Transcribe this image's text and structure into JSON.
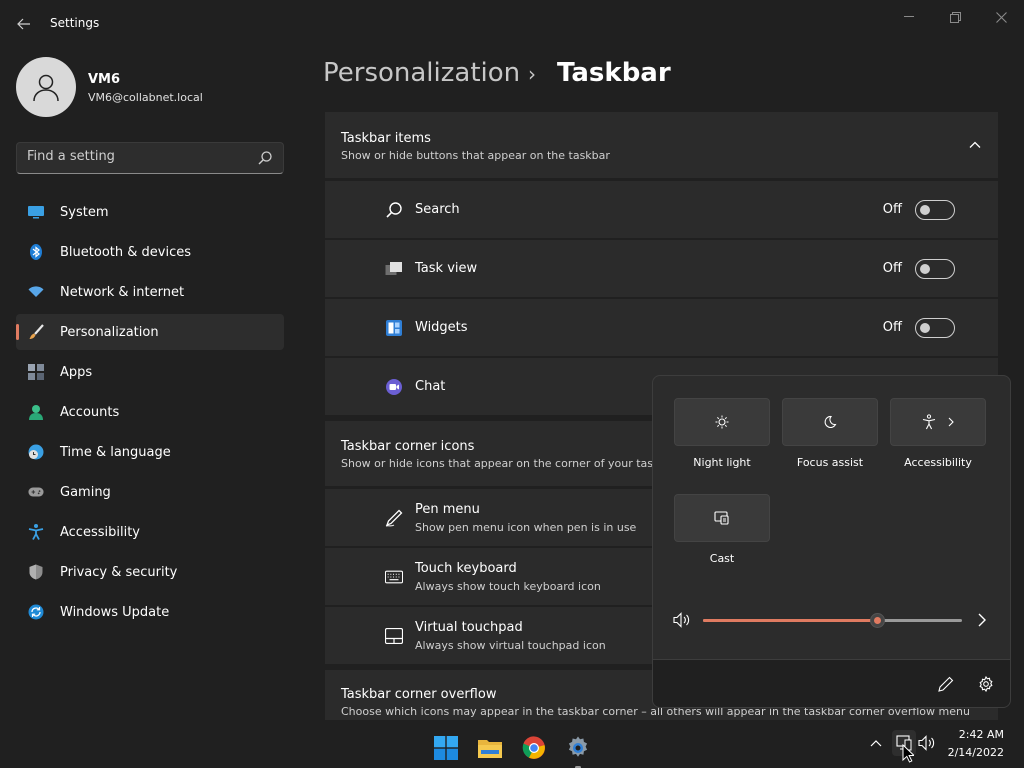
{
  "window": {
    "title": "Settings",
    "controls": {
      "minimize": "—",
      "restore": "❐",
      "close": "✕"
    }
  },
  "profile": {
    "name": "VM6",
    "email": "VM6@collabnet.local"
  },
  "search": {
    "placeholder": "Find a setting"
  },
  "sidebar": {
    "items": [
      {
        "label": "System",
        "icon": "system-icon",
        "active": false
      },
      {
        "label": "Bluetooth & devices",
        "icon": "bluetooth-icon",
        "active": false
      },
      {
        "label": "Network & internet",
        "icon": "wifi-icon",
        "active": false
      },
      {
        "label": "Personalization",
        "icon": "brush-icon",
        "active": true
      },
      {
        "label": "Apps",
        "icon": "apps-icon",
        "active": false
      },
      {
        "label": "Accounts",
        "icon": "accounts-icon",
        "active": false
      },
      {
        "label": "Time & language",
        "icon": "clock-globe-icon",
        "active": false
      },
      {
        "label": "Gaming",
        "icon": "gamepad-icon",
        "active": false
      },
      {
        "label": "Accessibility",
        "icon": "accessibility-icon",
        "active": false
      },
      {
        "label": "Privacy & security",
        "icon": "shield-icon",
        "active": false
      },
      {
        "label": "Windows Update",
        "icon": "update-icon",
        "active": false
      }
    ]
  },
  "header": {
    "parent": "Personalization",
    "separator": "›",
    "current": "Taskbar"
  },
  "taskbar_items": {
    "title": "Taskbar items",
    "subtitle": "Show or hide buttons that appear on the taskbar",
    "rows": [
      {
        "label": "Search",
        "state": "Off",
        "icon": "search-icon"
      },
      {
        "label": "Task view",
        "state": "Off",
        "icon": "task-view-icon"
      },
      {
        "label": "Widgets",
        "state": "Off",
        "icon": "widgets-icon"
      },
      {
        "label": "Chat",
        "icon": "chat-icon"
      }
    ]
  },
  "corner_icons": {
    "title": "Taskbar corner icons",
    "subtitle": "Show or hide icons that appear on the corner of your taskbar",
    "rows": [
      {
        "label": "Pen menu",
        "sub": "Show pen menu icon when pen is in use",
        "icon": "pen-icon"
      },
      {
        "label": "Touch keyboard",
        "sub": "Always show touch keyboard icon",
        "icon": "keyboard-icon"
      },
      {
        "label": "Virtual touchpad",
        "sub": "Always show virtual touchpad icon",
        "icon": "touchpad-icon"
      }
    ]
  },
  "corner_overflow": {
    "title": "Taskbar corner overflow",
    "subtitle": "Choose which icons may appear in the taskbar corner – all others will appear in the taskbar corner overflow menu"
  },
  "quick_settings": {
    "tiles": [
      {
        "label": "Night light",
        "icon": "night-light-icon"
      },
      {
        "label": "Focus assist",
        "icon": "moon-icon"
      },
      {
        "label": "Accessibility",
        "icon": "accessibility-icon"
      },
      {
        "label": "Cast",
        "icon": "cast-icon"
      }
    ],
    "volume_level": 0.67
  },
  "taskbar": {
    "apps": [
      "start-icon",
      "file-explorer-icon",
      "chrome-icon",
      "settings-icon"
    ],
    "clock_time": "2:42 AM",
    "clock_date": "2/14/2022"
  },
  "colors": {
    "accent": "#e07b61",
    "background": "#202020",
    "card": "#2b2b2b"
  }
}
